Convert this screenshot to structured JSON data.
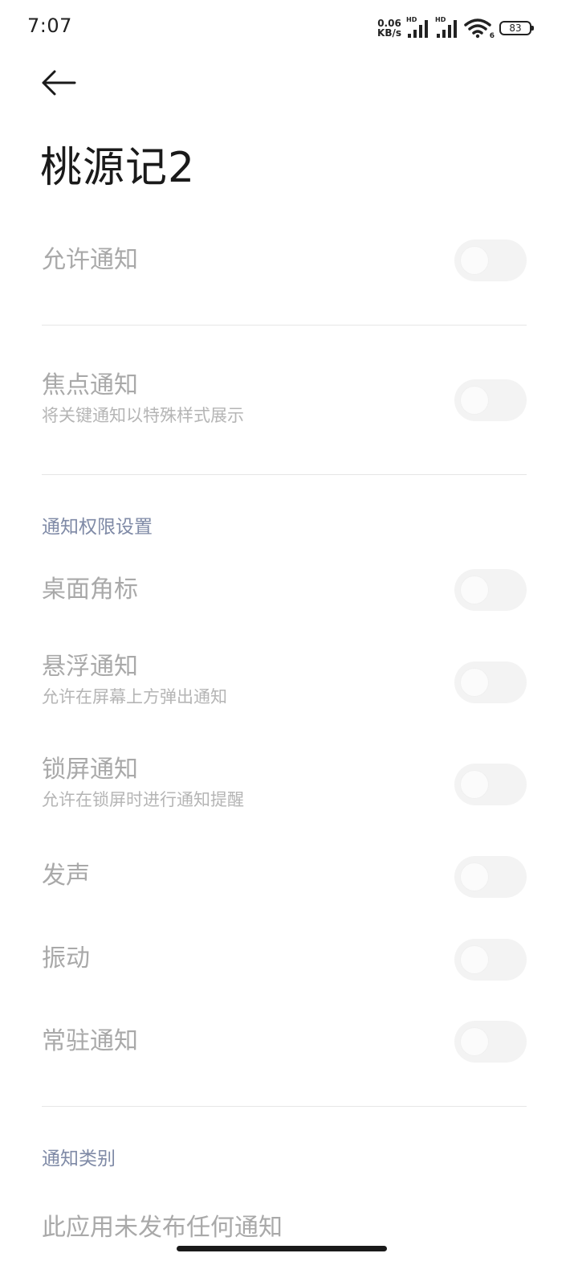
{
  "status_bar": {
    "time": "7:07",
    "net_speed_value": "0.06",
    "net_speed_unit": "KB/s",
    "hd1": "HD",
    "hd2": "HD",
    "battery": "83",
    "wifi_badge": "6"
  },
  "header": {
    "title": "桃源记2"
  },
  "settings": {
    "allow_notifications": {
      "title": "允许通知",
      "enabled": false
    },
    "focus_notifications": {
      "title": "焦点通知",
      "subtitle": "将关键通知以特殊样式展示",
      "enabled": false
    }
  },
  "permissions_section": {
    "header": "通知权限设置",
    "items": [
      {
        "title": "桌面角标",
        "subtitle": "",
        "enabled": false
      },
      {
        "title": "悬浮通知",
        "subtitle": "允许在屏幕上方弹出通知",
        "enabled": false
      },
      {
        "title": "锁屏通知",
        "subtitle": "允许在锁屏时进行通知提醒",
        "enabled": false
      },
      {
        "title": "发声",
        "subtitle": "",
        "enabled": false
      },
      {
        "title": "振动",
        "subtitle": "",
        "enabled": false
      },
      {
        "title": "常驻通知",
        "subtitle": "",
        "enabled": false
      }
    ]
  },
  "categories_section": {
    "header": "通知类别",
    "empty_text": "此应用未发布任何通知"
  }
}
